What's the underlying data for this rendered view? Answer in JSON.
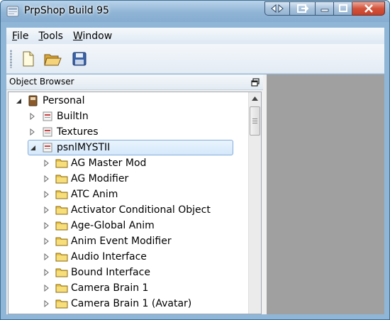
{
  "window": {
    "title": "PrpShop Build 95"
  },
  "menu": {
    "items": [
      {
        "underline": "F",
        "rest": "ile"
      },
      {
        "underline": "T",
        "rest": "ools"
      },
      {
        "underline": "W",
        "rest": "indow"
      }
    ]
  },
  "toolbar": {
    "buttons": [
      "new-file-icon",
      "open-folder-icon",
      "save-disk-icon"
    ]
  },
  "object_browser": {
    "title": "Object Browser",
    "tree": [
      {
        "label": "Personal",
        "level": 0,
        "expanded": true,
        "icon": "book-icon"
      },
      {
        "label": "BuiltIn",
        "level": 1,
        "expanded": false,
        "icon": "page-icon"
      },
      {
        "label": "Textures",
        "level": 1,
        "expanded": false,
        "icon": "page-icon"
      },
      {
        "label": "psnlMYSTII",
        "level": 1,
        "expanded": true,
        "icon": "page-icon",
        "selected": true
      },
      {
        "label": "AG Master Mod",
        "level": 2,
        "expanded": false,
        "icon": "folder-icon"
      },
      {
        "label": "AG Modifier",
        "level": 2,
        "expanded": false,
        "icon": "folder-icon"
      },
      {
        "label": "ATC Anim",
        "level": 2,
        "expanded": false,
        "icon": "folder-icon"
      },
      {
        "label": "Activator Conditional Object",
        "level": 2,
        "expanded": false,
        "icon": "folder-icon"
      },
      {
        "label": "Age-Global Anim",
        "level": 2,
        "expanded": false,
        "icon": "folder-icon"
      },
      {
        "label": "Anim Event Modifier",
        "level": 2,
        "expanded": false,
        "icon": "folder-icon"
      },
      {
        "label": "Audio Interface",
        "level": 2,
        "expanded": false,
        "icon": "folder-icon"
      },
      {
        "label": "Bound Interface",
        "level": 2,
        "expanded": false,
        "icon": "folder-icon"
      },
      {
        "label": "Camera Brain 1",
        "level": 2,
        "expanded": false,
        "icon": "folder-icon"
      },
      {
        "label": "Camera Brain 1 (Avatar)",
        "level": 2,
        "expanded": false,
        "icon": "folder-icon"
      }
    ]
  },
  "colors": {
    "title_bar": "#8fb4d5",
    "mdi_background": "#a0a0a0",
    "selection": "#d4e8fb",
    "close_button": "#d4533b"
  }
}
